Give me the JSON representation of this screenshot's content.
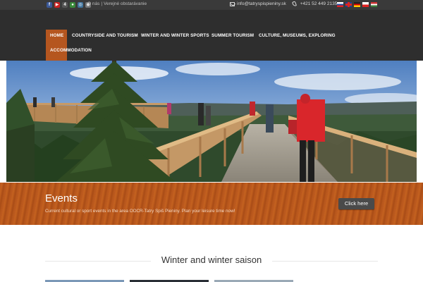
{
  "topbar": {
    "social_icons": [
      "facebook-icon",
      "youtube-icon",
      "foursquare-icon",
      "tripadvisor-icon",
      "instagram-icon",
      "camera-icon"
    ],
    "links": [
      "O nás",
      "Verejné obstarávanie"
    ],
    "link_separator": "|",
    "email": "info@tatryspispieniny.sk",
    "phone": "+421 52 449 2135",
    "flags": [
      "slovak-flag-icon",
      "english-flag-icon",
      "german-flag-icon",
      "polish-flag-icon",
      "hungarian-flag-icon"
    ]
  },
  "nav": {
    "items": [
      "HOME",
      "COUNTRYSIDE AND TOURISM",
      "WINTER AND WINTER SPORTS",
      "SUMMER TOURISM",
      "CULTURE, MUSEUMS, EXPLORING",
      "ACCOMMODATION"
    ],
    "active": "HOME"
  },
  "hero": {
    "image": "treetop-walkway-photo"
  },
  "events": {
    "title": "Events",
    "text": "Current cultural or sport events in the area OOCR-Tatry Spiš Pieniny. Plan your leisure time now!",
    "button": "Click here"
  },
  "section": {
    "title": "Winter and winter saison"
  },
  "colors": {
    "accent": "#b5561f",
    "topbar": "#3a3a3a",
    "header": "#2e2e2e",
    "button": "#4a4a4a"
  }
}
